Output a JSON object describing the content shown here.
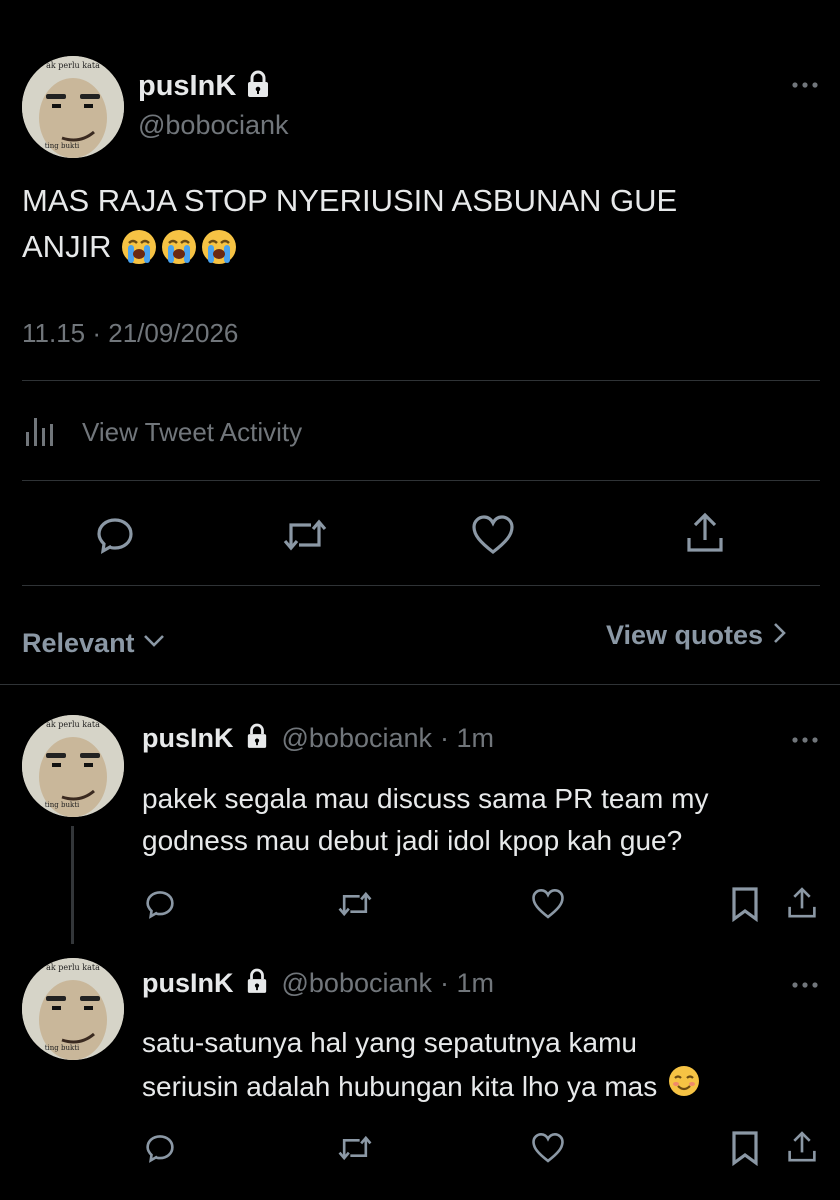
{
  "main_tweet": {
    "display_name": "pusInK",
    "handle": "@bobociank",
    "avatar_caption_top": "ak perlu kata",
    "avatar_caption_bottom": "ting bukti",
    "text_line1": "MAS RAJA STOP NYERIUSIN ASBUNAN GUE",
    "text_line2": "ANJIR",
    "timestamp": "11.15 · 21/09/2026",
    "activity_label": "View Tweet Activity"
  },
  "sort": {
    "label": "Relevant",
    "view_quotes_label": "View quotes"
  },
  "replies": [
    {
      "display_name": "pusInK",
      "handle": "@bobociank",
      "time": "· 1m",
      "text_line1": "pakek segala mau discuss sama PR team my",
      "text_line2": "godness mau debut jadi idol kpop kah gue?"
    },
    {
      "display_name": "pusInK",
      "handle": "@bobociank",
      "time": "· 1m",
      "text_line1": "satu-satunya hal yang sepatutnya kamu",
      "text_line2": "seriusin adalah hubungan kita lho ya mas"
    }
  ],
  "colors": {
    "background": "#000000",
    "text": "#e7e9ea",
    "muted": "#71767b",
    "divider": "#2f3336"
  }
}
